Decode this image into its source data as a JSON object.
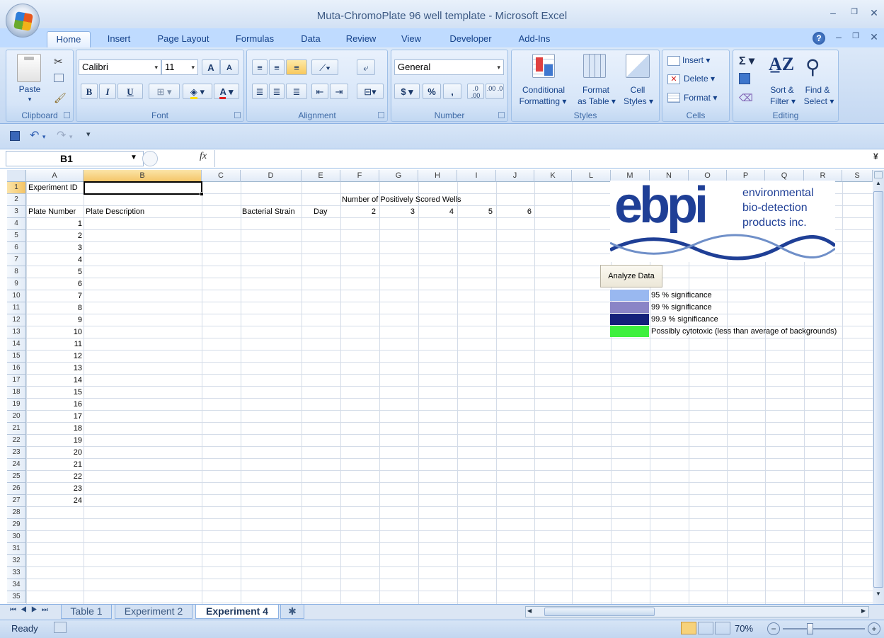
{
  "window": {
    "title": "Muta-ChromoPlate 96 well template - Microsoft Excel"
  },
  "ribbon_tabs": [
    "Home",
    "Insert",
    "Page Layout",
    "Formulas",
    "Data",
    "Review",
    "View",
    "Developer",
    "Add-Ins"
  ],
  "clipboard": {
    "paste": "Paste",
    "label": "Clipboard"
  },
  "font": {
    "name": "Calibri",
    "size": "11",
    "label": "Font",
    "bold": "B",
    "italic": "I",
    "underline": "U",
    "grow": "A",
    "shrink": "A",
    "color_letter": "A"
  },
  "alignment": {
    "label": "Alignment"
  },
  "number": {
    "format": "General",
    "label": "Number",
    "currency": "$",
    "percent": "%",
    "comma": ",",
    "inc_dec": ".0 .00",
    "dec_dec": ".00 .0"
  },
  "styles": {
    "label": "Styles",
    "cond_line1": "Conditional",
    "cond_line2": "Formatting ▾",
    "table_line1": "Format",
    "table_line2": "as Table ▾",
    "cell_line1": "Cell",
    "cell_line2": "Styles ▾"
  },
  "cells": {
    "label": "Cells",
    "insert": "Insert ▾",
    "delete": "Delete ▾",
    "format": "Format ▾"
  },
  "editing": {
    "label": "Editing",
    "sort_line1": "Sort &",
    "sort_line2": "Filter ▾",
    "find_line1": "Find &",
    "find_line2": "Select ▾"
  },
  "formula_bar": {
    "namebox": "B1",
    "fx": "fx",
    "formula": ""
  },
  "columns": [
    "A",
    "B",
    "C",
    "D",
    "E",
    "F",
    "G",
    "H",
    "I",
    "J",
    "K",
    "L",
    "M",
    "N",
    "O",
    "P",
    "Q",
    "R",
    "S"
  ],
  "rows": [
    "1",
    "2",
    "3",
    "4",
    "5",
    "6",
    "7",
    "8",
    "9",
    "10",
    "11",
    "12",
    "13",
    "14",
    "15",
    "16",
    "17",
    "18",
    "19",
    "20",
    "21",
    "22",
    "23",
    "24",
    "25",
    "26",
    "27",
    "28",
    "29",
    "30",
    "31",
    "32",
    "33",
    "34",
    "35"
  ],
  "sheet": {
    "a1": "Experiment ID",
    "f2": "Number of Positively Scored Wells",
    "a3": "Plate Number",
    "b3": "Plate Description",
    "d3": "Bacterial Strain",
    "e3": "Day",
    "f3": "2",
    "g3": "3",
    "h3": "4",
    "i3": "5",
    "j3": "6",
    "plate_numbers": [
      "1",
      "2",
      "3",
      "4",
      "5",
      "6",
      "7",
      "8",
      "9",
      "10",
      "11",
      "12",
      "13",
      "14",
      "15",
      "16",
      "17",
      "18",
      "19",
      "20",
      "21",
      "22",
      "23",
      "24"
    ]
  },
  "logo": {
    "letters": "ebpi",
    "line1": "environmental",
    "line2": "bio-detection",
    "line3": "products inc."
  },
  "analyze_button": "Analyze Data",
  "legend": [
    {
      "label": "95 % significance",
      "color": "#99b8f0"
    },
    {
      "label": "99 % significance",
      "color": "#8a84c6"
    },
    {
      "label": "99.9 % significance",
      "color": "#14207a"
    },
    {
      "label": "Possibly cytotoxic (less than average of backgrounds)",
      "color": "#3ef03e"
    }
  ],
  "sheet_tabs": [
    "Table 1",
    "Experiment 2",
    "Experiment 4"
  ],
  "status": {
    "ready": "Ready",
    "zoom": "70%"
  }
}
